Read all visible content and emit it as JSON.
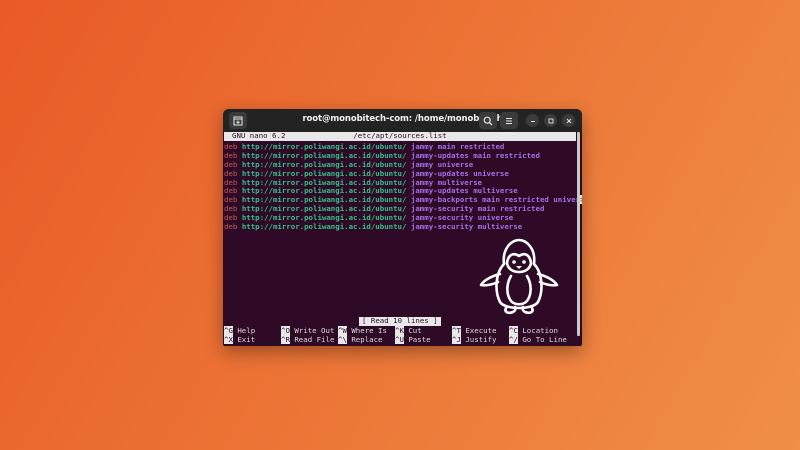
{
  "window": {
    "title": "root@monobitech-com: /home/monobitech"
  },
  "icons": {
    "new_tab": "new-tab-icon",
    "search": "search-icon",
    "menu": "hamburger-menu-icon",
    "minimize": "minimize-icon",
    "maximize": "maximize-icon",
    "close": "close-icon",
    "mascot": "penguin-icon"
  },
  "nano": {
    "version": "GNU nano 6.2",
    "filename": "/etc/apt/sources.list",
    "status": "[ Read 10 lines ]"
  },
  "sources": [
    {
      "type": "deb",
      "url": "http://mirror.poliwangi.ac.id/ubuntu/",
      "rest": "jammy main restricted"
    },
    {
      "type": "deb",
      "url": "http://mirror.poliwangi.ac.id/ubuntu/",
      "rest": "jammy-updates main restricted"
    },
    {
      "type": "deb",
      "url": "http://mirror.poliwangi.ac.id/ubuntu/",
      "rest": "jammy universe"
    },
    {
      "type": "deb",
      "url": "http://mirror.poliwangi.ac.id/ubuntu/",
      "rest": "jammy-updates universe"
    },
    {
      "type": "deb",
      "url": "http://mirror.poliwangi.ac.id/ubuntu/",
      "rest": "jammy multiverse"
    },
    {
      "type": "deb",
      "url": "http://mirror.poliwangi.ac.id/ubuntu/",
      "rest": "jammy-updates multiverse"
    },
    {
      "type": "deb",
      "url": "http://mirror.poliwangi.ac.id/ubuntu/",
      "rest": "jammy-backports main restricted univer",
      "cursor": ">"
    },
    {
      "type": "deb",
      "url": "http://mirror.poliwangi.ac.id/ubuntu/",
      "rest": "jammy-security main restricted"
    },
    {
      "type": "deb",
      "url": "http://mirror.poliwangi.ac.id/ubuntu/",
      "rest": "jammy-security universe"
    },
    {
      "type": "deb",
      "url": "http://mirror.poliwangi.ac.id/ubuntu/",
      "rest": "jammy-security multiverse"
    }
  ],
  "shortcuts": {
    "row1": [
      {
        "key": "^G",
        "label": "Help"
      },
      {
        "key": "^O",
        "label": "Write Out"
      },
      {
        "key": "^W",
        "label": "Where Is"
      },
      {
        "key": "^K",
        "label": "Cut"
      },
      {
        "key": "^T",
        "label": "Execute"
      },
      {
        "key": "^C",
        "label": "Location"
      }
    ],
    "row2": [
      {
        "key": "^X",
        "label": "Exit"
      },
      {
        "key": "^R",
        "label": "Read File"
      },
      {
        "key": "^\\",
        "label": "Replace"
      },
      {
        "key": "^U",
        "label": "Paste"
      },
      {
        "key": "^J",
        "label": "Justify"
      },
      {
        "key": "^/",
        "label": "Go To Line"
      }
    ]
  },
  "colors": {
    "terminal_bg": "#2f0a27",
    "keyword": "#c05a56",
    "url": "#33c088",
    "distribution": "#a070e8",
    "titlebar": "#232323"
  }
}
